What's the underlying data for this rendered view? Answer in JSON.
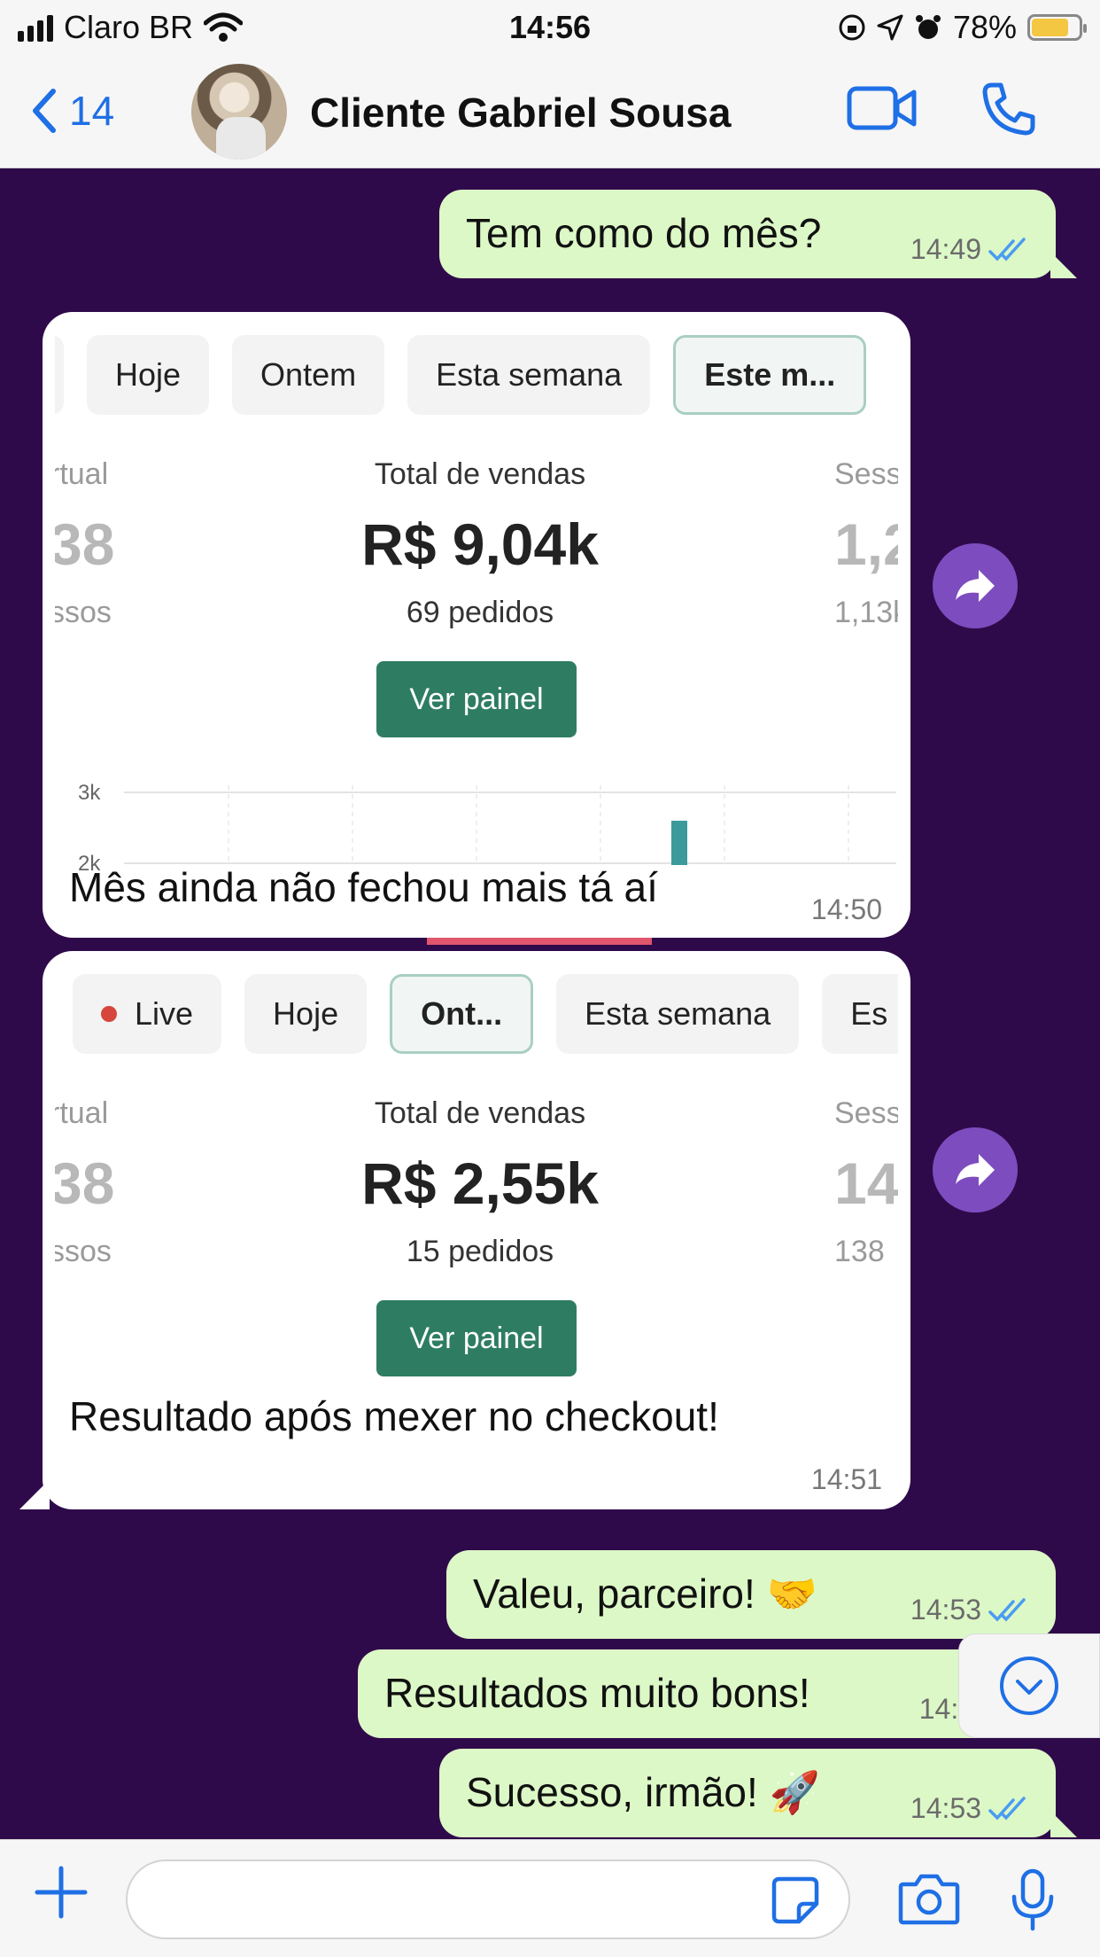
{
  "status_bar": {
    "carrier": "Claro BR",
    "time": "14:56",
    "battery": "78%",
    "battery_level": 0.78
  },
  "header": {
    "back_count": "14",
    "contact_name": "Cliente Gabriel Sousa",
    "icons": [
      "chevron-left-icon",
      "video-call-icon",
      "phone-call-icon"
    ]
  },
  "messages": {
    "m1": {
      "text": "Tem como do mês?",
      "time": "14:49"
    },
    "card1": {
      "tabs": [
        "Hoje",
        "Ontem",
        "Esta semana",
        "Este m..."
      ],
      "left_label": "rtual",
      "left_value": "38",
      "left_sub": "ssos",
      "center_label": "Total de vendas",
      "center_value": "R$ 9,04k",
      "center_sub": "69 pedidos",
      "right_label": "Sess",
      "right_value": "1,2",
      "right_sub": "1,13k",
      "button": "Ver painel",
      "chart_ticks": [
        "3k",
        "2k"
      ],
      "caption": "Mês ainda não fechou mais tá aí",
      "time": "14:50"
    },
    "card2": {
      "tabs": [
        "Live",
        "Hoje",
        "Ont...",
        "Esta semana",
        "Es"
      ],
      "left_label": "rtual",
      "left_value": "38",
      "left_sub": "ssos",
      "center_label": "Total de vendas",
      "center_value": "R$ 2,55k",
      "center_sub": "15 pedidos",
      "right_label": "Sess",
      "right_value": "14",
      "right_sub": "138",
      "button": "Ver painel",
      "caption": "Resultado após mexer no checkout!",
      "time": "14:51"
    },
    "m3": {
      "text": "Valeu, parceiro! 🤝",
      "time": "14:53"
    },
    "m4": {
      "text": "Resultados muito bons!",
      "time": "14:5"
    },
    "m5": {
      "text": "Sucesso, irmão! 🚀",
      "time": "14:53"
    }
  },
  "colors": {
    "chat_bg": "#2f0a4a",
    "out_bubble": "#dcf8c6",
    "accent_blue": "#1f6fe5",
    "panel_green": "#2e7d62",
    "forward_purple": "#7d4cbf"
  }
}
